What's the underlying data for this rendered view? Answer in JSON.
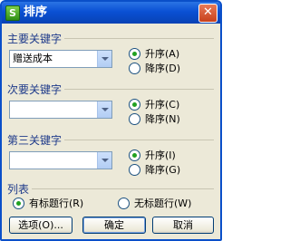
{
  "window": {
    "title": "排序",
    "app_icon": "S",
    "close_glyph": "✕"
  },
  "primary_key": {
    "label": "主要关键字",
    "selected": "赠送成本",
    "asc_label": "升序(A)",
    "desc_label": "降序(D)",
    "order": "asc"
  },
  "secondary_key": {
    "label": "次要关键字",
    "selected": "",
    "asc_label": "升序(C)",
    "desc_label": "降序(N)",
    "order": "asc"
  },
  "tertiary_key": {
    "label": "第三关键字",
    "selected": "",
    "asc_label": "升序(I)",
    "desc_label": "降序(G)",
    "order": "asc"
  },
  "list": {
    "label": "列表",
    "with_header_label": "有标题行(R)",
    "without_header_label": "无标题行(W)",
    "selected": "with_header"
  },
  "buttons": {
    "options": "选项(O)...",
    "ok": "确定",
    "cancel": "取消"
  },
  "colors": {
    "title_bar": "#0a50d4",
    "accent_radio": "#21a121"
  }
}
